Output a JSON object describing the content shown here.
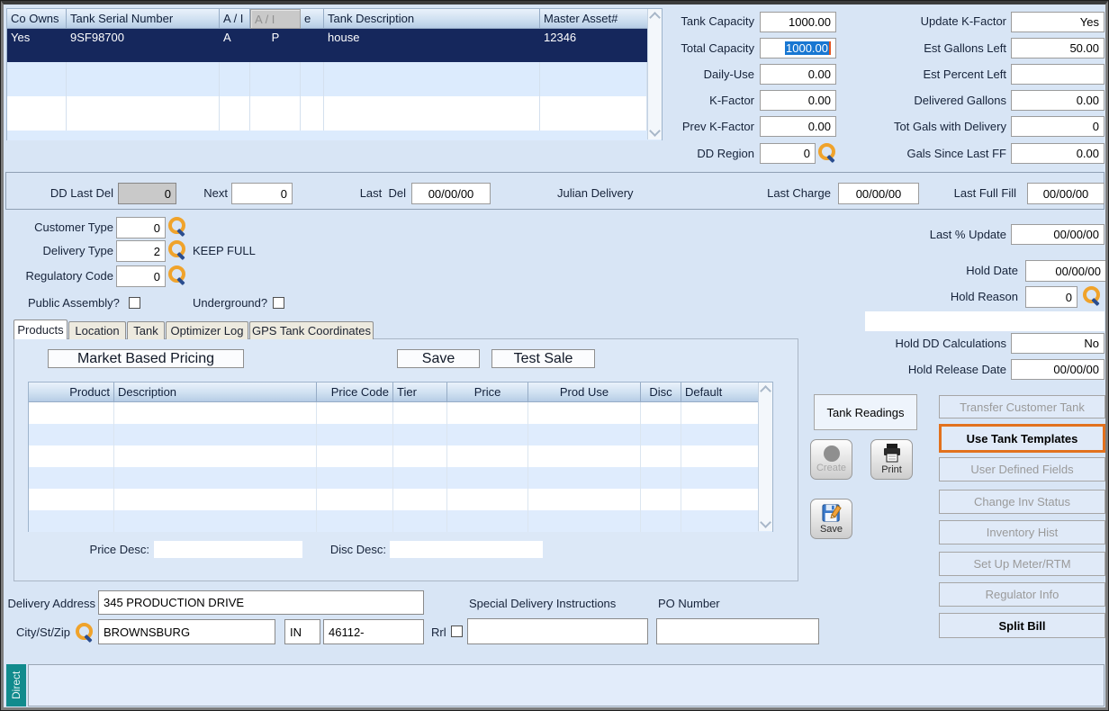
{
  "grid": {
    "headers": {
      "co_owns": "Co Owns",
      "serial": "Tank Serial Number",
      "ai": "A / I",
      "overlay": "A / I",
      "partial": "e",
      "description": "Tank Description",
      "master_asset": "Master Asset#"
    },
    "row": {
      "co_owns": "Yes",
      "serial": "9SF98700",
      "ai": "A",
      "use": "P",
      "description": "house",
      "master_asset": "12346"
    }
  },
  "capacity": {
    "left": [
      {
        "label": "Tank Capacity",
        "value": "1000.00"
      },
      {
        "label": "Total Capacity",
        "value": "1000.00"
      },
      {
        "label": "Daily-Use",
        "value": "0.00"
      },
      {
        "label": "K-Factor",
        "value": "0.00"
      },
      {
        "label": "Prev K-Factor",
        "value": "0.00"
      },
      {
        "label": "DD Region",
        "value": "0"
      }
    ],
    "right": [
      {
        "label": "Update K-Factor",
        "value": "Yes"
      },
      {
        "label": "Est Gallons Left",
        "value": "50.00"
      },
      {
        "label": "Est Percent Left",
        "value": ""
      },
      {
        "label": "Delivered Gallons",
        "value": "0.00"
      },
      {
        "label": "Tot Gals with Delivery",
        "value": "0"
      },
      {
        "label": "Gals Since Last FF",
        "value": "0.00"
      }
    ]
  },
  "band": {
    "dd_last_del_label": "DD Last Del",
    "dd_last_del_value": "0",
    "next_label": "Next",
    "next_value": "0",
    "last_del_label": "Last  Del",
    "last_del_value": "00/00/00",
    "julian_label": "Julian Delivery",
    "last_charge_label": "Last Charge",
    "last_charge_value": "00/00/00",
    "last_full_fill_label": "Last Full Fill",
    "last_full_fill_value": "00/00/00"
  },
  "customer": {
    "customer_type_label": "Customer Type",
    "customer_type_value": "0",
    "delivery_type_label": "Delivery Type",
    "delivery_type_value": "2",
    "delivery_type_desc": "KEEP FULL",
    "regulatory_code_label": "Regulatory Code",
    "regulatory_code_value": "0",
    "public_assembly_label": "Public Assembly?",
    "underground_label": "Underground?"
  },
  "hold": {
    "last_pct_update_label": "Last % Update",
    "last_pct_update_value": "00/00/00",
    "hold_date_label": "Hold Date",
    "hold_date_value": "00/00/00",
    "hold_reason_label": "Hold Reason",
    "hold_reason_value": "0",
    "hold_dd_label": "Hold DD Calculations",
    "hold_dd_value": "No",
    "hold_release_label": "Hold Release Date",
    "hold_release_value": "00/00/00"
  },
  "tabs": [
    {
      "label": "Products"
    },
    {
      "label": "Location"
    },
    {
      "label": "Tank"
    },
    {
      "label": "Optimizer Log"
    },
    {
      "label": "GPS Tank Coordinates"
    }
  ],
  "products": {
    "market_based_pricing_label": "Market Based Pricing",
    "save_label": "Save",
    "test_sale_label": "Test Sale",
    "columns": [
      "Product",
      "Description",
      "Price Code",
      "Tier",
      "Price",
      "Prod Use",
      "Disc",
      "Default"
    ],
    "price_desc_label": "Price Desc:",
    "price_desc_value": "",
    "disc_desc_label": "Disc Desc:",
    "disc_desc_value": ""
  },
  "actions": {
    "tank_readings_label": "Tank Readings",
    "create_label": "Create",
    "print_label": "Print",
    "save_label": "Save",
    "buttons": [
      {
        "label": "Transfer Customer Tank"
      },
      {
        "label": "Use Tank Templates"
      },
      {
        "label": "User Defined Fields"
      },
      {
        "label": "Change Inv Status"
      },
      {
        "label": "Inventory Hist"
      },
      {
        "label": "Set Up Meter/RTM"
      },
      {
        "label": "Regulator Info"
      },
      {
        "label": "Split Bill"
      }
    ]
  },
  "address": {
    "delivery_address_label": "Delivery Address",
    "delivery_address_value": "345 PRODUCTION DRIVE",
    "special_instructions_label": "Special Delivery Instructions",
    "special_instructions_value": "",
    "po_number_label": "PO Number",
    "po_number_value": "",
    "city_label": "City/St/Zip",
    "city_value": "BROWNSBURG",
    "state_value": "IN",
    "zip_value": "46112-",
    "rrl_label": "Rrl"
  },
  "footer": {
    "direct_label": "Direct"
  },
  "colors": {
    "selected_row": "#15275c",
    "selection_blue": "#1877d2",
    "highlight_border": "#e2711d",
    "teal_tab": "#118b8d",
    "magnifier_ring": "#f0a32b"
  }
}
